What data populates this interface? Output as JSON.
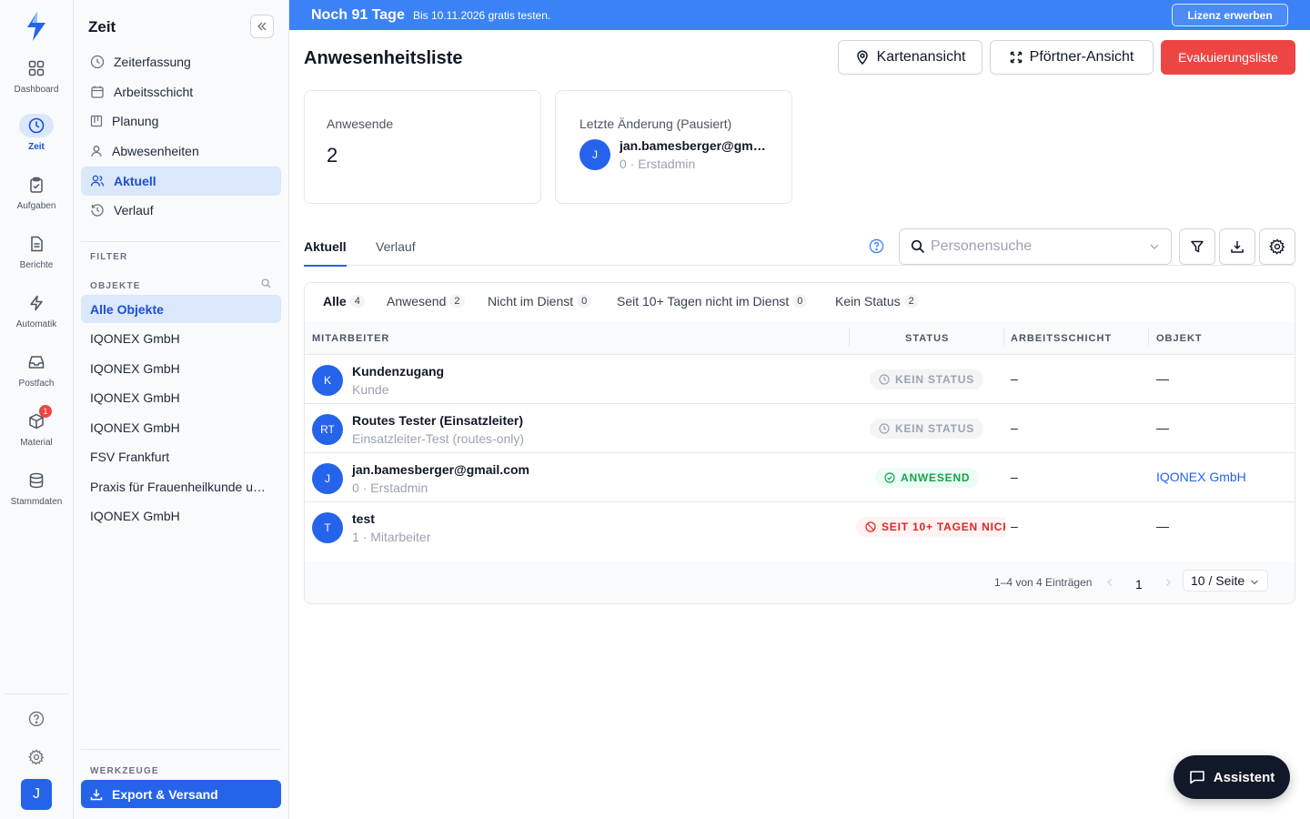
{
  "rail": {
    "items": [
      {
        "label": "Dashboard",
        "icon": "grid-icon"
      },
      {
        "label": "Zeit",
        "icon": "clock-icon",
        "active": true
      },
      {
        "label": "Aufgaben",
        "icon": "clipboard-icon"
      },
      {
        "label": "Berichte",
        "icon": "document-icon"
      },
      {
        "label": "Automatik",
        "icon": "bolt-icon"
      },
      {
        "label": "Postfach",
        "icon": "inbox-icon"
      },
      {
        "label": "Material",
        "icon": "box-icon",
        "badge": "1"
      },
      {
        "label": "Stammdaten",
        "icon": "database-icon"
      }
    ],
    "user_initial": "J"
  },
  "sidebar": {
    "title": "Zeit",
    "nav": [
      {
        "label": "Zeiterfassung",
        "icon": "clock-icon"
      },
      {
        "label": "Arbeitsschicht",
        "icon": "calendar-icon"
      },
      {
        "label": "Planung",
        "icon": "board-icon"
      },
      {
        "label": "Abwesenheiten",
        "icon": "person-icon"
      },
      {
        "label": "Aktuell",
        "icon": "people-icon",
        "active": true
      },
      {
        "label": "Verlauf",
        "icon": "history-icon"
      }
    ],
    "filter_label": "FILTER",
    "objects_label": "OBJEKTE",
    "objects": [
      "Alle Objekte",
      "IQONEX GmbH",
      "IQONEX GmbH",
      "IQONEX GmbH",
      "IQONEX GmbH",
      "FSV Frankfurt",
      "Praxis für Frauenheilkunde un…",
      "IQONEX GmbH"
    ],
    "tools_label": "WERKZEUGE",
    "export_label": "Export & Versand"
  },
  "banner": {
    "title": "Noch 91 Tage",
    "subtitle": "Bis 10.11.2026 gratis testen.",
    "button": "Lizenz erwerben"
  },
  "header": {
    "title": "Anwesenheitsliste",
    "map_button": "Kartenansicht",
    "gate_button": "Pförtner-Ansicht",
    "evac_button": "Evakuierungsliste"
  },
  "cards": {
    "present_label": "Anwesende",
    "present_count": "2",
    "last_change_label": "Letzte Änderung (Pausiert)",
    "last_change_initial": "J",
    "last_change_name": "jan.bamesberger@gm…",
    "last_change_sub": "0 · Erstadmin"
  },
  "tabs": [
    "Aktuell",
    "Verlauf"
  ],
  "search": {
    "placeholder": "Personensuche"
  },
  "filters": [
    {
      "label": "Alle",
      "count": "4"
    },
    {
      "label": "Anwesend",
      "count": "2"
    },
    {
      "label": "Nicht im Dienst",
      "count": "0"
    },
    {
      "label": "Seit 10+ Tagen nicht im Dienst",
      "count": "0"
    },
    {
      "label": "Kein Status",
      "count": "2"
    }
  ],
  "table": {
    "columns": [
      "MITARBEITER",
      "STATUS",
      "ARBEITSSCHICHT",
      "OBJEKT"
    ],
    "rows": [
      {
        "initials": "K",
        "name": "Kundenzugang",
        "sub": "Kunde",
        "status": "KEIN STATUS",
        "shift": "–",
        "object": "—"
      },
      {
        "initials": "RT",
        "name": "Routes Tester (Einsatzleiter)",
        "sub": "Einsatzleiter-Test (routes-only)",
        "status": "KEIN STATUS",
        "shift": "–",
        "object": "—"
      },
      {
        "initials": "J",
        "name": "jan.bamesberger@gmail.com",
        "sub": "0 · Erstadmin",
        "status": "ANWESEND",
        "shift": "–",
        "object": "IQONEX GmbH"
      },
      {
        "initials": "T",
        "name": "test",
        "sub": "1 · Mitarbeiter",
        "status": "SEIT 10+ TAGEN NICH",
        "shift": "–",
        "object": "—"
      }
    ]
  },
  "pagination": {
    "info": "1–4 von 4 Einträgen",
    "page": "1",
    "per_page": "10 / Seite"
  },
  "assistant": {
    "label": "Assistent"
  },
  "colors": {
    "primary": "#2563eb",
    "danger": "#ef4444",
    "success": "#16a34a",
    "banner": "#3b82f6"
  }
}
